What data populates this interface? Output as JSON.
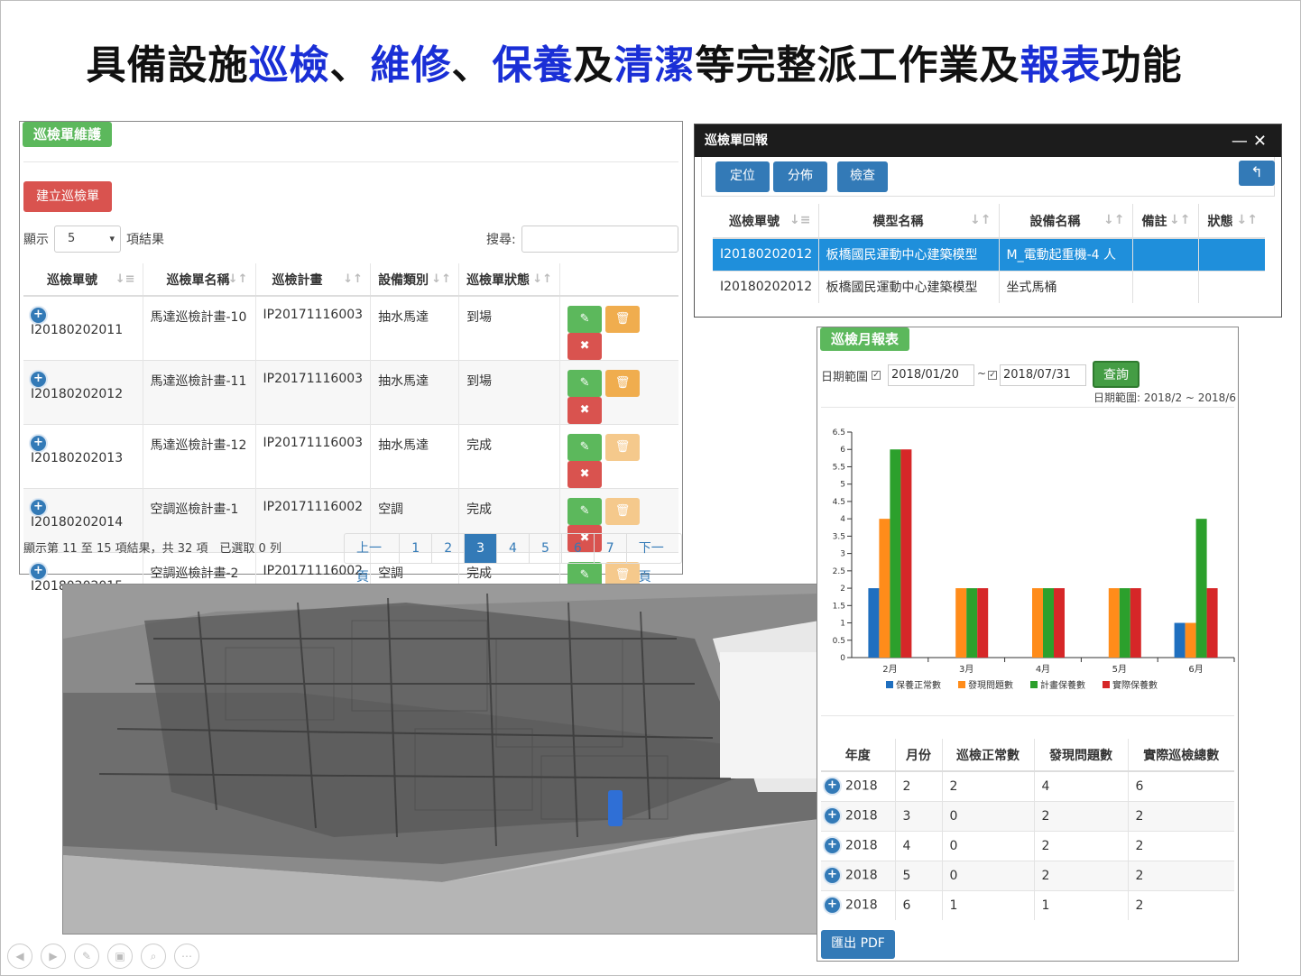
{
  "title": {
    "p1": "具備設施",
    "h1": "巡檢",
    "p2": "、",
    "h2": "維修",
    "p3": "、",
    "h3": "保養",
    "p4": "及",
    "h4": "清潔",
    "p5": "等完整派工作業及",
    "h5": "報表",
    "p6": "功能"
  },
  "maint": {
    "tag": "巡檢單維護",
    "create_btn": "建立巡檢單",
    "show_label": "顯示",
    "page_size": "5",
    "results_label": "項結果",
    "search_label": "搜尋:",
    "headers": [
      "巡檢單號",
      "巡檢單名稱",
      "巡檢計畫",
      "設備類別",
      "巡檢單狀態"
    ],
    "rows": [
      [
        "I20180202011",
        "馬達巡檢計畫-10",
        "IP20171116003",
        "抽水馬達",
        "到場"
      ],
      [
        "I20180202012",
        "馬達巡檢計畫-11",
        "IP20171116003",
        "抽水馬達",
        "到場"
      ],
      [
        "I20180202013",
        "馬達巡檢計畫-12",
        "IP20171116003",
        "抽水馬達",
        "完成"
      ],
      [
        "I20180202014",
        "空調巡檢計畫-1",
        "IP20171116002",
        "空調",
        "完成"
      ],
      [
        "I20180202015",
        "空調巡檢計畫-2",
        "IP20171116002",
        "空調",
        "完成"
      ]
    ],
    "info": "顯示第 11 至 15 項結果，共 32 項　已選取 0 列",
    "pager": {
      "prev": "上一頁",
      "pages": [
        "1",
        "2",
        "3",
        "4",
        "5",
        "6",
        "7"
      ],
      "next": "下一頁",
      "active": "3"
    }
  },
  "report": {
    "title": "巡檢單回報",
    "btns": [
      "定位",
      "分佈",
      "檢查"
    ],
    "headers": [
      "巡檢單號",
      "模型名稱",
      "設備名稱",
      "備註",
      "狀態"
    ],
    "rows": [
      [
        "I20180202012",
        "板橋國民運動中心建築模型",
        "M_電動起重機-4 人",
        "",
        ""
      ],
      [
        "I20180202012",
        "板橋國民運動中心建築模型",
        "坐式馬桶",
        "",
        ""
      ]
    ]
  },
  "monthly": {
    "tag": "巡檢月報表",
    "date_label": "日期範圍",
    "from": "2018/01/20",
    "tilde": "~",
    "to": "2018/07/31",
    "query": "查詢",
    "range_text": "日期範圍: 2018/2 ~ 2018/6",
    "headers": [
      "年度",
      "月份",
      "巡檢正常數",
      "發現問題數",
      "實際巡檢總數"
    ],
    "rows": [
      [
        "2018",
        "2",
        "2",
        "4",
        "6"
      ],
      [
        "2018",
        "3",
        "0",
        "2",
        "2"
      ],
      [
        "2018",
        "4",
        "0",
        "2",
        "2"
      ],
      [
        "2018",
        "5",
        "0",
        "2",
        "2"
      ],
      [
        "2018",
        "6",
        "1",
        "1",
        "2"
      ]
    ],
    "export": "匯出 PDF"
  },
  "chart_data": {
    "type": "bar",
    "categories": [
      "2月",
      "3月",
      "4月",
      "5月",
      "6月"
    ],
    "series": [
      {
        "name": "保養正常數",
        "color": "#1f6fbf",
        "values": [
          2,
          0,
          0,
          0,
          1
        ]
      },
      {
        "name": "發現問題數",
        "color": "#ff8c1a",
        "values": [
          4,
          2,
          2,
          2,
          1
        ]
      },
      {
        "name": "計畫保養數",
        "color": "#2ca02c",
        "values": [
          6,
          2,
          2,
          2,
          4
        ]
      },
      {
        "name": "實際保養數",
        "color": "#d62728",
        "values": [
          6,
          2,
          2,
          2,
          2
        ]
      }
    ],
    "yticks": [
      "0",
      "0.5",
      "1",
      "1.5",
      "2",
      "2.5",
      "3",
      "3.5",
      "4",
      "4.5",
      "5",
      "5.5",
      "6",
      "6.5"
    ],
    "ylim": [
      0,
      6.5
    ],
    "legend": "bottom"
  }
}
